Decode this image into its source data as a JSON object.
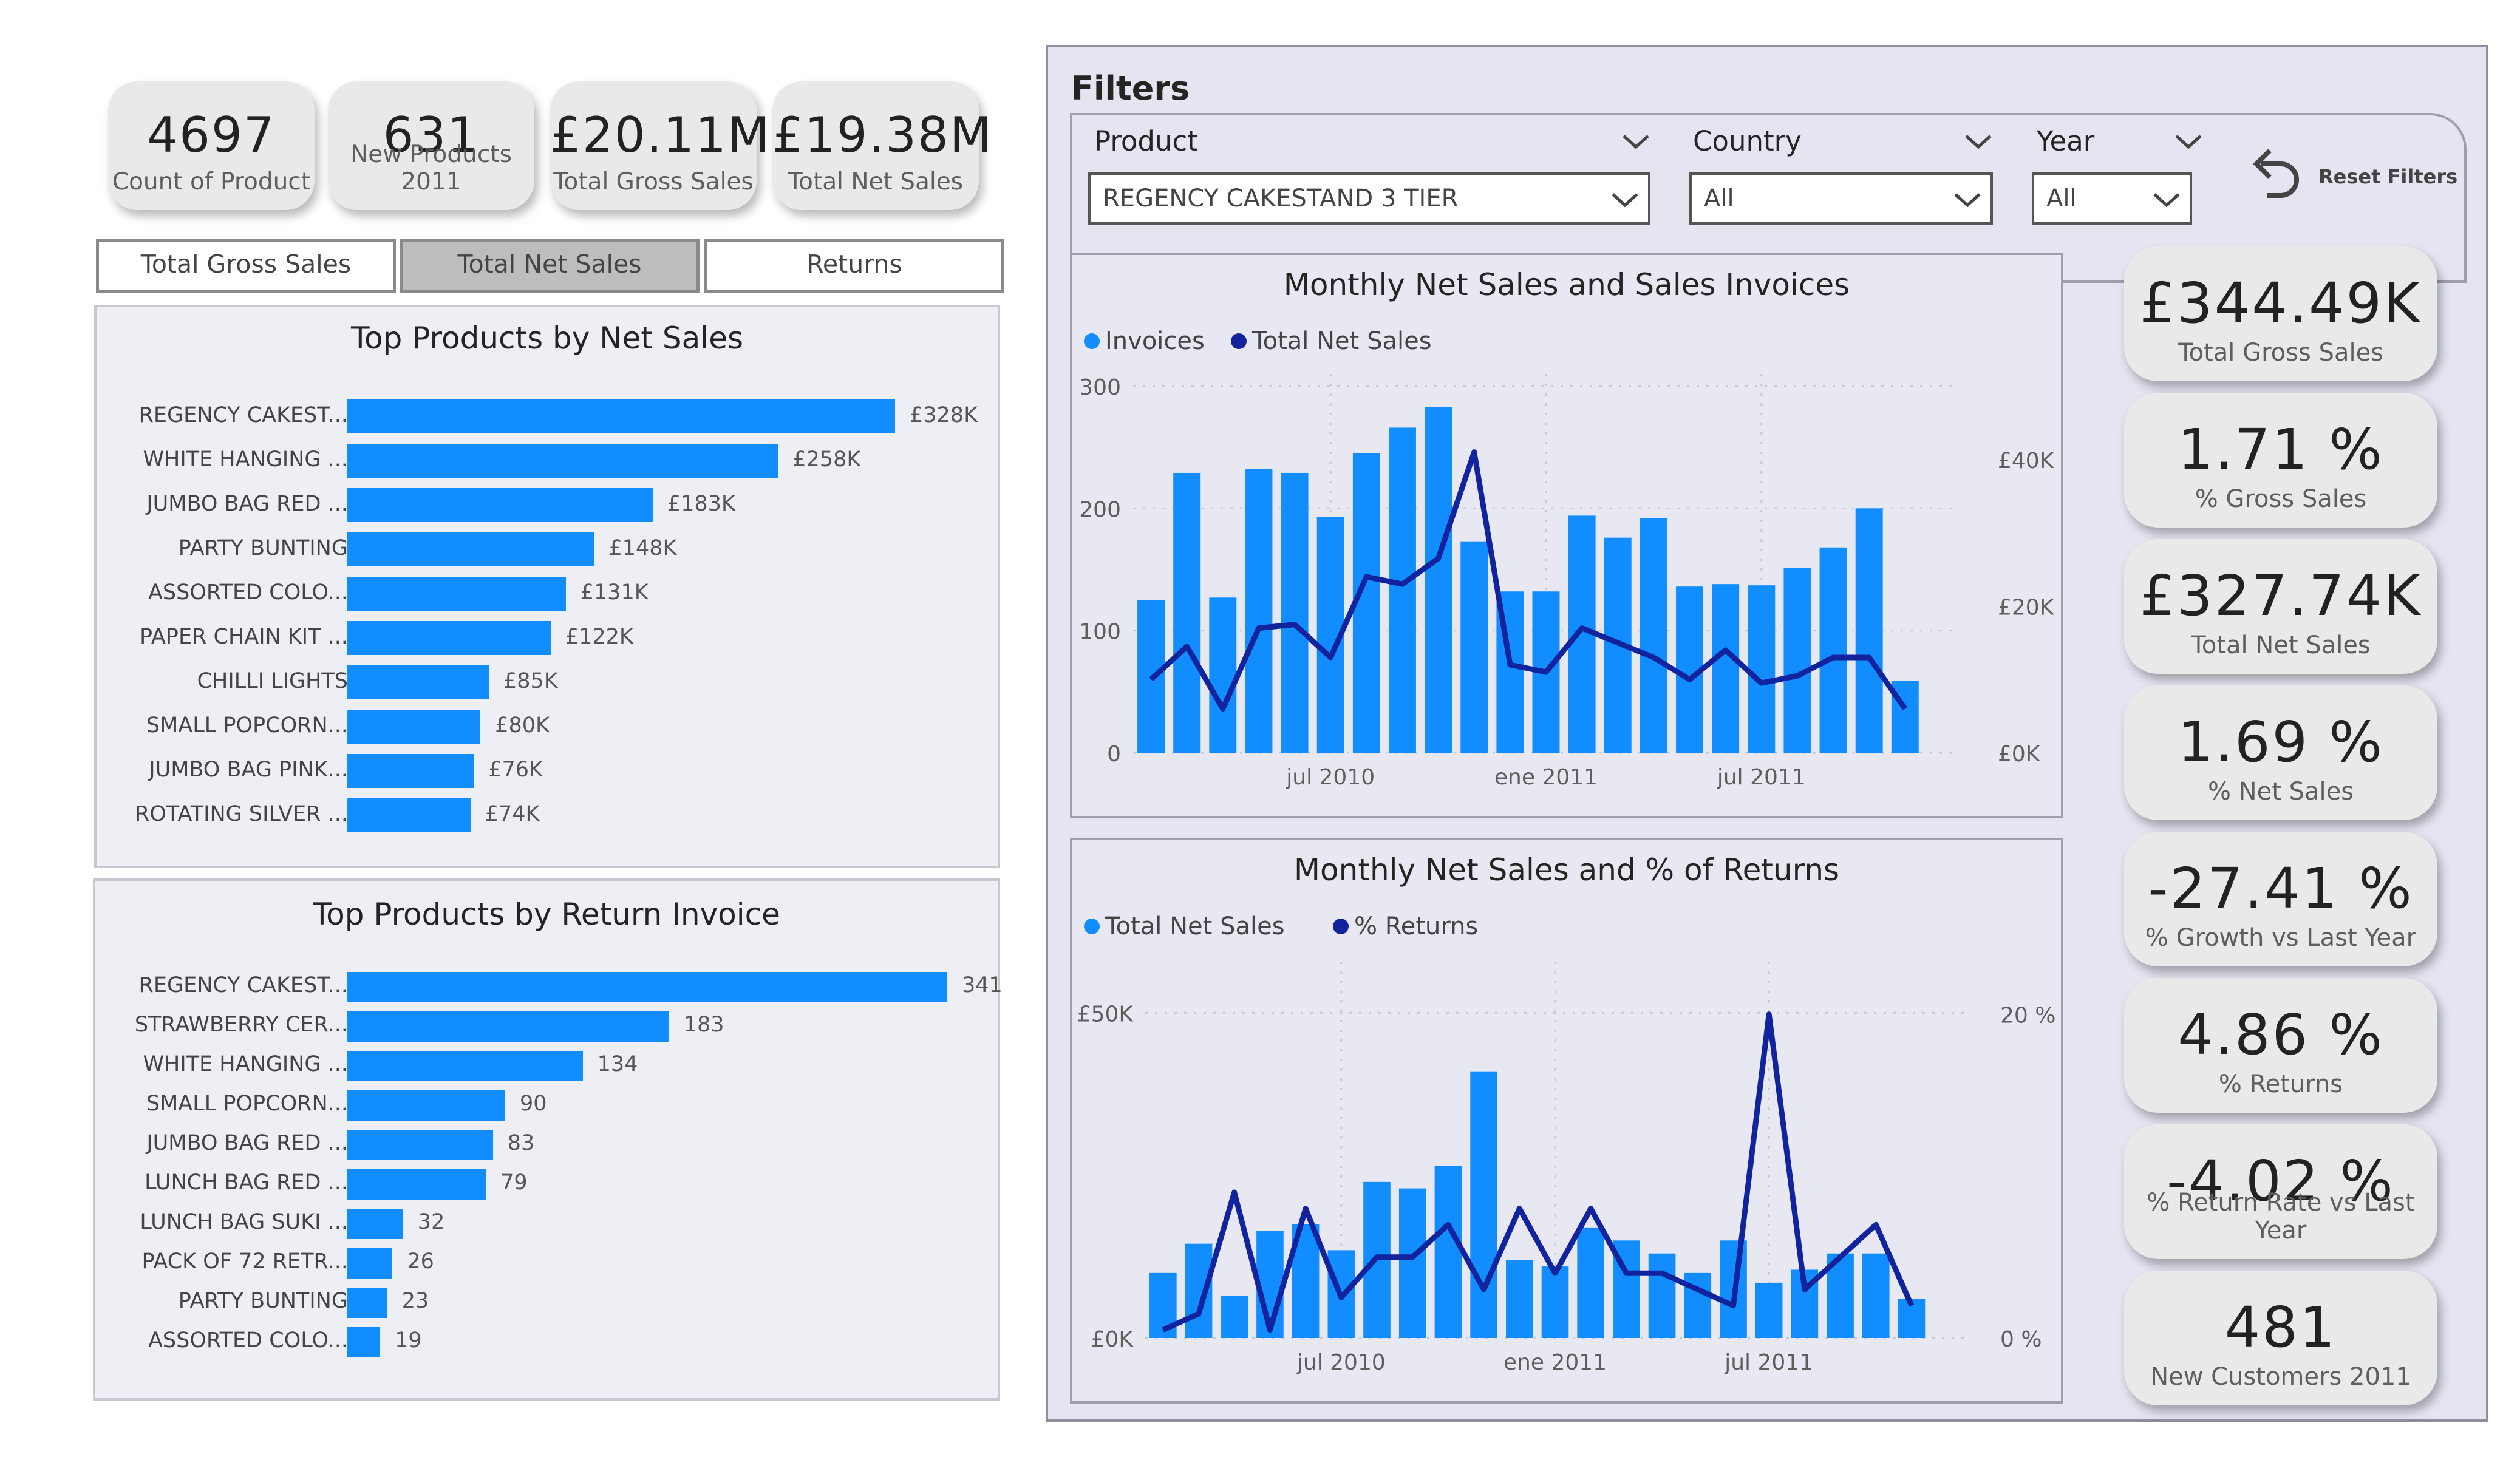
{
  "top_kpis": [
    {
      "value": "4697",
      "label": "Count of Product"
    },
    {
      "value": "631",
      "label": "New Products 2011"
    },
    {
      "value": "£20.11M",
      "label": "Total Gross Sales"
    },
    {
      "value": "£19.38M",
      "label": "Total Net Sales"
    }
  ],
  "measure_buttons": [
    {
      "label": "Total Gross Sales",
      "selected": false
    },
    {
      "label": "Total Net Sales",
      "selected": true
    },
    {
      "label": "Returns",
      "selected": false
    }
  ],
  "filters": {
    "title": "Filters",
    "product": {
      "label": "Product",
      "value": "REGENCY CAKESTAND 3 TIER"
    },
    "country": {
      "label": "Country",
      "value": "All"
    },
    "year": {
      "label": "Year",
      "value": "All"
    },
    "reset_label": "Reset Filters"
  },
  "side_kpis": [
    {
      "value": "£344.49K",
      "label": "Total Gross Sales"
    },
    {
      "value": "1.71 %",
      "label": "% Gross Sales"
    },
    {
      "value": "£327.74K",
      "label": "Total Net Sales"
    },
    {
      "value": "1.69 %",
      "label": "% Net Sales"
    },
    {
      "value": "-27.41 %",
      "label": "% Growth vs Last Year"
    },
    {
      "value": "4.86 %",
      "label": "% Returns"
    },
    {
      "value": "-4.02 %",
      "label": "% Return Rate vs Last Year"
    },
    {
      "value": "481",
      "label": "New Customers 2011"
    }
  ],
  "colors": {
    "bar": "#118dff",
    "line": "#12239e"
  },
  "chart_data": [
    {
      "type": "bar",
      "title": "Top Products by Net Sales",
      "categories": [
        "REGENCY CAKEST...",
        "WHITE HANGING ...",
        "JUMBO BAG RED ...",
        "PARTY BUNTING",
        "ASSORTED COLO...",
        "PAPER CHAIN KIT ...",
        "CHILLI LIGHTS",
        "SMALL POPCORN...",
        "JUMBO BAG PINK...",
        "ROTATING SILVER ..."
      ],
      "values": [
        328,
        258,
        183,
        148,
        131,
        122,
        85,
        80,
        76,
        74
      ],
      "labels": [
        "£328K",
        "£258K",
        "£183K",
        "£148K",
        "£131K",
        "£122K",
        "£85K",
        "£80K",
        "£76K",
        "£74K"
      ],
      "orientation": "horizontal"
    },
    {
      "type": "bar",
      "title": "Top Products by Return Invoice",
      "categories": [
        "REGENCY CAKEST...",
        "STRAWBERRY CER...",
        "WHITE HANGING ...",
        "SMALL POPCORN...",
        "JUMBO BAG RED ...",
        "LUNCH BAG RED ...",
        "LUNCH BAG SUKI ...",
        "PACK OF 72 RETR...",
        "PARTY BUNTING",
        "ASSORTED COLO..."
      ],
      "values": [
        341,
        183,
        134,
        90,
        83,
        79,
        32,
        26,
        23,
        19
      ],
      "labels": [
        "341",
        "183",
        "134",
        "90",
        "83",
        "79",
        "32",
        "26",
        "23",
        "19"
      ],
      "orientation": "horizontal"
    },
    {
      "type": "bar",
      "title": "Monthly Net Sales and Sales Invoices",
      "x": [
        "2010-01",
        "2010-02",
        "2010-03",
        "2010-04",
        "2010-05",
        "2010-06",
        "2010-07",
        "2010-08",
        "2010-09",
        "2010-10",
        "2010-11",
        "2010-12",
        "2011-01",
        "2011-02",
        "2011-03",
        "2011-04",
        "2011-05",
        "2011-06",
        "2011-07",
        "2011-08",
        "2011-09",
        "2011-10",
        "2011-11"
      ],
      "x_ticks": [
        "jul 2010",
        "ene 2011",
        "jul 2011"
      ],
      "series": [
        {
          "name": "Invoices",
          "type": "bar",
          "axis": "left",
          "values": [
            125,
            229,
            127,
            232,
            229,
            193,
            245,
            266,
            283,
            173,
            132,
            132,
            194,
            176,
            192,
            136,
            138,
            137,
            151,
            168,
            200,
            59,
            0
          ]
        },
        {
          "name": "Total Net Sales",
          "type": "line",
          "axis": "right",
          "values": [
            10000,
            14500,
            6000,
            17000,
            17500,
            13000,
            24000,
            23000,
            26500,
            41000,
            12000,
            11000,
            17000,
            15000,
            13000,
            10000,
            14000,
            9500,
            10500,
            13000,
            13000,
            6000,
            null
          ]
        }
      ],
      "left_axis": {
        "ticks": [
          "0",
          "100",
          "200",
          "300"
        ],
        "range": [
          0,
          300
        ]
      },
      "right_axis": {
        "ticks": [
          "£0K",
          "£20K",
          "£40K"
        ],
        "range": [
          0,
          50000
        ]
      }
    },
    {
      "type": "bar",
      "title": "Monthly Net Sales and % of Returns",
      "x": [
        "2010-01",
        "2010-02",
        "2010-03",
        "2010-04",
        "2010-05",
        "2010-06",
        "2010-07",
        "2010-08",
        "2010-09",
        "2010-10",
        "2010-11",
        "2010-12",
        "2011-01",
        "2011-02",
        "2011-03",
        "2011-04",
        "2011-05",
        "2011-06",
        "2011-07",
        "2011-08",
        "2011-09",
        "2011-10",
        "2011-11"
      ],
      "x_ticks": [
        "jul 2010",
        "ene 2011",
        "jul 2011"
      ],
      "series": [
        {
          "name": "Total Net Sales",
          "type": "bar",
          "axis": "left",
          "values": [
            10000,
            14500,
            6500,
            16500,
            17500,
            13500,
            24000,
            23000,
            26500,
            41000,
            12000,
            11000,
            17000,
            15000,
            13000,
            10000,
            15000,
            8500,
            10500,
            13000,
            13000,
            6000,
            null
          ]
        },
        {
          "name": "% Returns",
          "type": "line",
          "axis": "right",
          "values": [
            0.5,
            1.5,
            9,
            0.5,
            8,
            2.5,
            5,
            5,
            7,
            3,
            8,
            4,
            8,
            4,
            4,
            3,
            2,
            20,
            3,
            5,
            7,
            2,
            null
          ]
        }
      ],
      "left_axis": {
        "ticks": [
          "£0K",
          "£50K"
        ],
        "range": [
          0,
          56000
        ]
      },
      "right_axis": {
        "ticks": [
          "0 %",
          "20 %"
        ],
        "range": [
          0,
          22.5
        ]
      }
    }
  ]
}
